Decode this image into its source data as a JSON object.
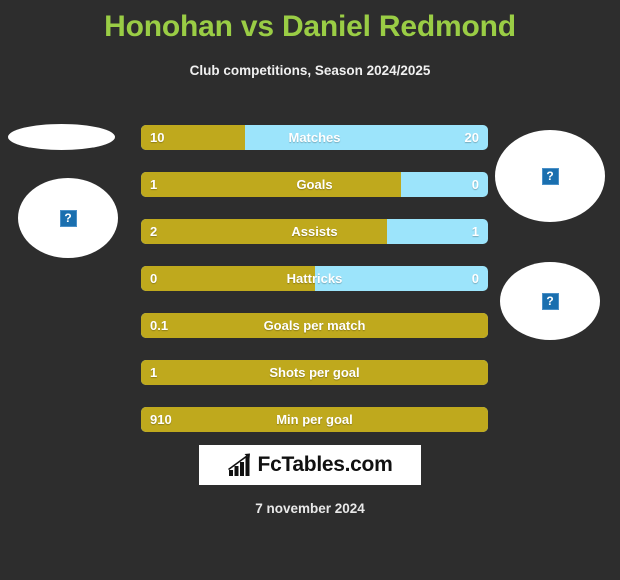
{
  "header": {
    "title": "Honohan vs Daniel Redmond",
    "subtitle": "Club competitions, Season 2024/2025"
  },
  "colors": {
    "background": "#2d2d2d",
    "title_green": "#9ACD45",
    "bar_gold": "#BFA91D",
    "bar_blue": "#9CE4FB",
    "text_white": "#ffffff"
  },
  "avatars": [
    {
      "name": "home-flag",
      "placeholder_glyph": "?",
      "shape": "flat-ellipse"
    },
    {
      "name": "home-player",
      "placeholder_glyph": "?",
      "shape": "oval"
    },
    {
      "name": "away-player",
      "placeholder_glyph": "?",
      "shape": "circle"
    },
    {
      "name": "away-flag",
      "placeholder_glyph": "?",
      "shape": "oval"
    }
  ],
  "stats": [
    {
      "label": "Matches",
      "left": "10",
      "right": "20",
      "gold_percent": 30,
      "has_right": true
    },
    {
      "label": "Goals",
      "left": "1",
      "right": "0",
      "gold_percent": 75,
      "has_right": true
    },
    {
      "label": "Assists",
      "left": "2",
      "right": "1",
      "gold_percent": 71,
      "has_right": true
    },
    {
      "label": "Hattricks",
      "left": "0",
      "right": "0",
      "gold_percent": 50,
      "has_right": true
    },
    {
      "label": "Goals per match",
      "left": "0.1",
      "right": "",
      "gold_percent": 100,
      "has_right": false
    },
    {
      "label": "Shots per goal",
      "left": "1",
      "right": "",
      "gold_percent": 100,
      "has_right": false
    },
    {
      "label": "Min per goal",
      "left": "910",
      "right": "",
      "gold_percent": 100,
      "has_right": false
    }
  ],
  "logo": {
    "text": "FcTables.com",
    "icon": "bar-chart-up-icon"
  },
  "footer": {
    "date": "7 november 2024"
  },
  "chart_data": {
    "type": "bar",
    "title": "Honohan vs Daniel Redmond",
    "subtitle": "Club competitions, Season 2024/2025",
    "categories": [
      "Matches",
      "Goals",
      "Assists",
      "Hattricks",
      "Goals per match",
      "Shots per goal",
      "Min per goal"
    ],
    "series": [
      {
        "name": "Honohan",
        "color": "#BFA91D",
        "values": [
          10,
          1,
          2,
          0,
          0.1,
          1,
          910
        ]
      },
      {
        "name": "Daniel Redmond",
        "color": "#9CE4FB",
        "values": [
          20,
          0,
          1,
          0,
          null,
          null,
          null
        ]
      }
    ],
    "layout": "horizontal-paired-bars",
    "legend": "none",
    "grid": false
  }
}
